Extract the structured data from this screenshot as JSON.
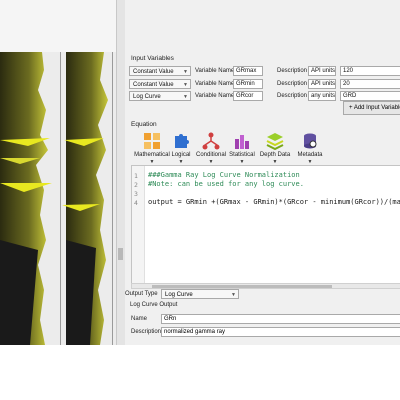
{
  "input_variables": {
    "header": "Input Variables",
    "rows": [
      {
        "type": "Constant Value",
        "name_label": "Variable Name",
        "name": "GRmax",
        "desc_label": "Description",
        "desc": "API units)",
        "value": "120"
      },
      {
        "type": "Constant Value",
        "name_label": "Variable Name",
        "name": "GRmin",
        "desc_label": "Description",
        "desc": "API units)",
        "value": "20"
      },
      {
        "type": "Log Curve",
        "name_label": "Variable Name",
        "name": "GRcor",
        "desc_label": "Description",
        "desc": "any units)",
        "value": "GRD"
      }
    ],
    "add_button": "+ Add Input Variable"
  },
  "equation": {
    "header": "Equation",
    "toolbar": [
      {
        "label": "Mathematical",
        "icon": "calculator-icon"
      },
      {
        "label": "Logical",
        "icon": "puzzle-icon"
      },
      {
        "label": "Conditional",
        "icon": "branch-icon"
      },
      {
        "label": "Statistical",
        "icon": "bar-chart-icon"
      },
      {
        "label": "Depth Data",
        "icon": "layers-icon"
      },
      {
        "label": "Metadata",
        "icon": "database-icon"
      }
    ],
    "lines": [
      {
        "num": "1",
        "text": "###Gamma Ray Log Curve Normalization"
      },
      {
        "num": "2",
        "text": "#Note: can be used for any log curve."
      },
      {
        "num": "3",
        "text": ""
      },
      {
        "num": "4",
        "text": "output = GRmin +(GRmax - GRmin)*(GRcor - minimum(GRcor))/(maxi"
      }
    ]
  },
  "output": {
    "type_label": "Output Type",
    "type_value": "Log Curve",
    "section_label": "Log Curve Output",
    "name_label": "Name",
    "name_value": "GRn",
    "desc_label": "Description",
    "desc_value": "normalized gamma ray"
  },
  "colors": {
    "accent_yellow": "#d8d82a",
    "panel_bg": "#f0f0f0",
    "comment_green": "#2e8b57",
    "function_purple": "#7a2ab0"
  }
}
